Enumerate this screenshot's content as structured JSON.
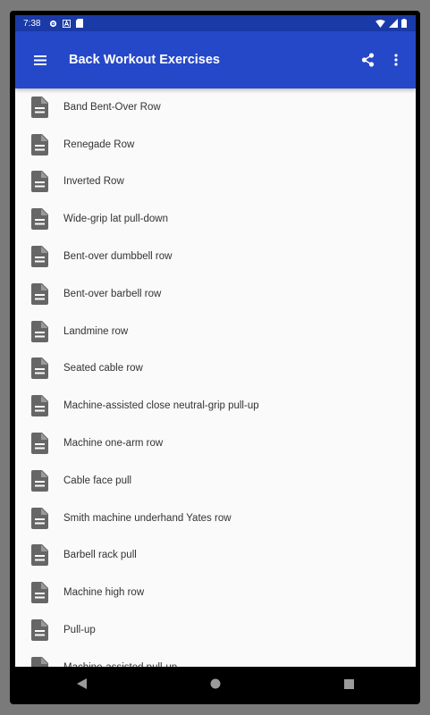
{
  "status": {
    "time": "7:38"
  },
  "appbar": {
    "title": "Back Workout Exercises"
  },
  "list": {
    "items": [
      "Band Bent-Over Row",
      "Renegade Row",
      "Inverted Row",
      "Wide-grip lat pull-down",
      "Bent-over dumbbell row",
      "Bent-over barbell row",
      "Landmine row",
      "Seated cable row",
      "Machine-assisted close neutral-grip pull-up",
      "Machine one-arm row",
      "Cable face pull",
      "Smith machine underhand Yates row",
      "Barbell rack pull",
      "Machine high row",
      "Pull-up",
      "Machine-assisted pull-up"
    ]
  },
  "colors": {
    "status_bar": "#1a3aa8",
    "app_bar": "#2548c8",
    "list_bg": "#fafafa",
    "icon": "#666666"
  }
}
